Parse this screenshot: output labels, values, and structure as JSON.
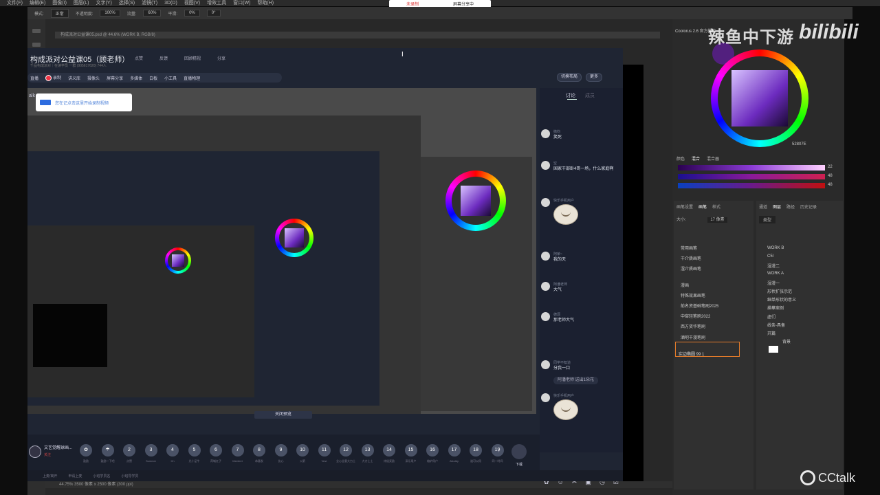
{
  "ps": {
    "menu": [
      "文件(F)",
      "编辑(E)",
      "图像(I)",
      "图层(L)",
      "文字(Y)",
      "选择(S)",
      "滤镜(T)",
      "3D(D)",
      "视图(V)",
      "增效工具",
      "窗口(W)",
      "帮助(H)"
    ],
    "options": {
      "mode_label": "模式:",
      "mode_value": "正常",
      "opacity_label": "不透明度:",
      "opacity_value": "100%",
      "flow_label": "流量:",
      "flow_value": "60%",
      "smooth_label": "平滑:",
      "smooth_value": "0%",
      "angle_value": "0°"
    },
    "doc_tab": "构成派对公益课05.psd @ 44.6% (WORK B, RGB/8)",
    "status": "44.75%   3500 像素 x 2500 像素 (300 ppi)"
  },
  "rec_badge": {
    "status": "未录制",
    "share": "屏幕分享中"
  },
  "cctalk": {
    "title": "构成派对公益课05（顾老师）",
    "subtitle": "千品构成派对｜在读学员 一群 (905617620)    744人",
    "top_actions": [
      "点赞",
      "反馈",
      "回顾精视",
      "分享"
    ],
    "toolbar": [
      "直播",
      "录制",
      "讲义库",
      "摄像头",
      "屏幕分享",
      "多媒体",
      "白板",
      "小工具",
      "直播物理"
    ],
    "btn_layout": "切换布局",
    "btn_more": "更多",
    "tip": "您在记点击这里开始录制视频",
    "lk": "alk",
    "close_preview": "关闭预览",
    "chat_tabs": {
      "active": "讨论",
      "other": "成员"
    },
    "messages": [
      {
        "name": "搞钧",
        "text": "笑死",
        "emoji": false
      },
      {
        "name": "空",
        "text": "国家干部卧4哥一场，什么家庭啊",
        "emoji": false
      },
      {
        "name": "快乐手机用户",
        "text": "",
        "emoji": true
      },
      {
        "name": "阿荣~",
        "text": "我的天",
        "emoji": false
      },
      {
        "name": "阿潘老师",
        "text": "大气",
        "emoji": false
      },
      {
        "name": "德源",
        "text": "那老师大气",
        "emoji": false
      },
      {
        "name": "同学不知道",
        "text": "分我一口",
        "emoji": false
      },
      {
        "name": "快乐手机用户",
        "text": "",
        "emoji": true
      }
    ],
    "system_msg": "阿潘老师 送出1朵花",
    "chat_icons": [
      "✿",
      "☺",
      "✂",
      "▣",
      "◷",
      "☑"
    ],
    "host": {
      "name": "文艺觉醒球画...",
      "sub": "关注"
    },
    "gifts": [
      {
        "n": "✿",
        "label": "鼓励"
      },
      {
        "n": "☂",
        "label": "鼓励一下吧"
      },
      {
        "n": "2",
        "label": "点赞"
      },
      {
        "n": "3",
        "label": "Summer"
      },
      {
        "n": "4",
        "label": "Ch"
      },
      {
        "n": "5",
        "label": "光十足牛"
      },
      {
        "n": "6",
        "label": "荷城红子"
      },
      {
        "n": "7",
        "label": "Meeteet"
      },
      {
        "n": "8",
        "label": "恭喜发"
      },
      {
        "n": "9",
        "label": "比心"
      },
      {
        "n": "10",
        "label": "火箭"
      },
      {
        "n": "11",
        "label": "Vest"
      },
      {
        "n": "12",
        "label": "全心全意大力士"
      },
      {
        "n": "13",
        "label": "大力士士"
      },
      {
        "n": "14",
        "label": "终极奖励"
      },
      {
        "n": "15",
        "label": "采乐用户"
      },
      {
        "n": "16",
        "label": "熔炉用户"
      },
      {
        "n": "17",
        "label": "Alloddy"
      },
      {
        "n": "18",
        "label": "道可以用"
      },
      {
        "n": "19",
        "label": "同一时间"
      }
    ],
    "gift_send": "下载",
    "bottom_bar": [
      "上麦/离开",
      "申请上麦",
      "小班学员名",
      "小班导学员"
    ]
  },
  "coloreus": {
    "title": "Coolorus 2.6 官方推广",
    "hex": "52807E",
    "tabs": [
      "颜色",
      "混合",
      "混合器"
    ],
    "sliders": [
      {
        "v": "22"
      },
      {
        "v": "48"
      },
      {
        "v": "48"
      }
    ]
  },
  "brushes": {
    "tabs": [
      "画笔设置",
      "画笔",
      "样式"
    ],
    "size_label": "大小:",
    "size_value": "17 像素",
    "items": [
      "常用画笔",
      "干介质画笔",
      "湿介质画笔",
      "漫画",
      "特殊效果画笔",
      "前名资基础笔刷2025",
      "中窑轻笔刷2022",
      "西方资华笔刷",
      "酒吧干漫笔刷"
    ],
    "selected": "实边椭圆 99 1"
  },
  "layers": {
    "tabs": [
      "通道",
      "图层",
      "路径",
      "历史记录"
    ],
    "kind": "类型",
    "items": [
      "WORK B",
      "C5l",
      "湿漫二",
      "WORK A",
      "湿漫一",
      "形状扩张示范",
      "细单形状的意义",
      "描摹案例",
      "虚们",
      "线条-具备",
      "开篇",
      "背景"
    ]
  },
  "watermarks": {
    "top": "辣鱼中下游",
    "bili": "bilibili",
    "cctalk": "CCtalk"
  }
}
